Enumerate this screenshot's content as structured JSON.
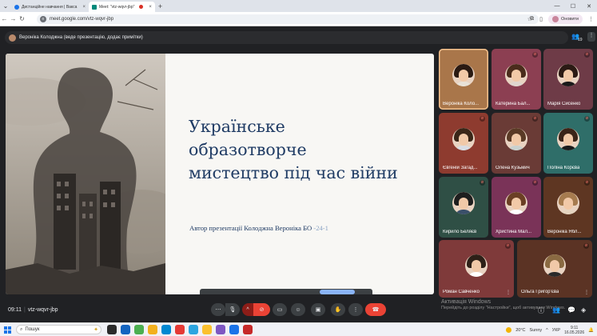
{
  "browser": {
    "tabs": [
      {
        "title": "Дистанційне навчання | Вакса",
        "favicon_color": "#1a73e8",
        "active": false
      },
      {
        "title": "Meet: \"vtz-wqvr-jbp\"",
        "favicon_color": "#00897b",
        "active": true
      }
    ],
    "url": "meet.google.com/vtz-wqvr-jbp",
    "profile_label": "Оновити"
  },
  "meet": {
    "presenter_banner": "Вероніка Колоджна (веде презентацію, додає примітки)",
    "people_count": "19",
    "slide": {
      "title_lines": [
        "Українське",
        "образотворче",
        "мистецтво під час війни"
      ],
      "author_text": "Автор презентації  Колоджна Вероніка БО",
      "group_suffix": "-24-1"
    },
    "participants": [
      {
        "name": "Вероніка Коло...",
        "bg": "#a9764a",
        "hair": "#2a1a12",
        "shirt": "#e8e2d8",
        "speaking": true,
        "muted": false
      },
      {
        "name": "Катерина Бал...",
        "bg": "#8c3f52",
        "hair": "#4a2c1c",
        "shirt": "#e0d6cf",
        "speaking": false,
        "muted": true
      },
      {
        "name": "Марія Сисенко",
        "bg": "#6e3b47",
        "hair": "#2b1a14",
        "shirt": "#1a1a1a",
        "speaking": false,
        "muted": true
      },
      {
        "name": "Євгеній Загад...",
        "bg": "#8e3b2f",
        "hair": "#3a2618",
        "shirt": "#d9dde4",
        "speaking": false,
        "muted": true
      },
      {
        "name": "Олена Кузьмич",
        "bg": "#6a3b36",
        "hair": "#5a3a26",
        "shirt": "#c9d1cf",
        "speaking": false,
        "muted": true
      },
      {
        "name": "Поліна Корєва",
        "bg": "#2f6e69",
        "hair": "#3b2418",
        "shirt": "#1a1a1a",
        "speaking": false,
        "muted": true
      },
      {
        "name": "Кирило Беляєв",
        "bg": "#2f4f45",
        "hair": "#1e1e1e",
        "shirt": "#3a4f6a",
        "speaking": false,
        "muted": true
      },
      {
        "name": "Христина Мал...",
        "bg": "#7a3358",
        "hair": "#6b3f24",
        "shirt": "#ffffff",
        "speaking": false,
        "muted": true
      },
      {
        "name": "Вероніка Ябл...",
        "bg": "#5e3622",
        "hair": "#a67b4f",
        "shirt": "#e5d4c0",
        "speaking": false,
        "muted": true
      },
      {
        "name": "Роман Савченко",
        "bg": "#7f3a3a",
        "hair": "#2d2018",
        "shirt": "#ffffff",
        "speaking": false,
        "muted": true
      },
      {
        "name": "Ольга Григор'єва",
        "bg": "#5b3324",
        "hair": "#8a6a42",
        "shirt": "#2a2a2a",
        "speaking": false,
        "muted": true
      }
    ],
    "watermark_title": "Активація Windows",
    "watermark_sub": "Перейдіть до розділу \"Настройки\", щоб активувати Windows.",
    "time": "09:11",
    "meeting_code": "vtz-wqvr-jbp"
  },
  "taskbar": {
    "search_label": "Пошук",
    "weather": "20°C",
    "weather_desc": "Sunny",
    "lang": "УКР",
    "clock_time": "9:11",
    "clock_date": "16.05.2026",
    "app_colors": [
      "#2b2b2b",
      "#1565c0",
      "#4caf50",
      "#f2b01e",
      "#0288d1",
      "#e53935",
      "#2ca5e0",
      "#fbc02d",
      "#7e57c2",
      "#1a73e8",
      "#c62828"
    ]
  }
}
